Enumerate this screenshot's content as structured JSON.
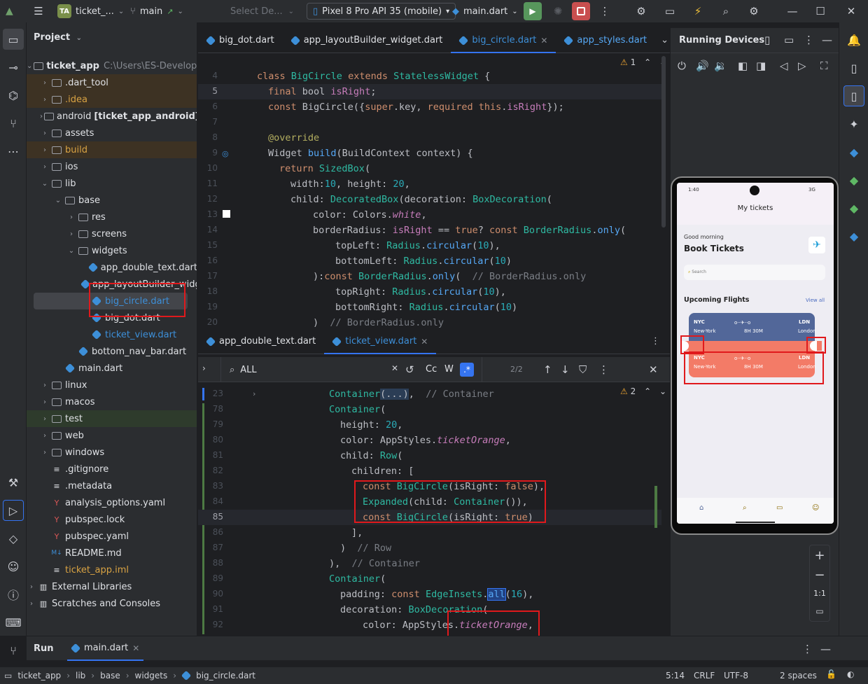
{
  "titlebar": {
    "project_badge": "TA",
    "project_name": "ticket_...",
    "branch": "main",
    "config_placeholder": "Select De...",
    "device": "Pixel 8 Pro API 35 (mobile)",
    "run_config": "main.dart"
  },
  "project_panel": {
    "title": "Project",
    "root_name": "ticket_app",
    "root_path": "C:\\Users\\ES-Developer-s",
    "items": [
      {
        "label": ".dart_tool",
        "kind": "folder"
      },
      {
        "label": ".idea",
        "kind": "folder"
      },
      {
        "label": "android",
        "suffix": "[ticket_app_android]",
        "kind": "folder"
      },
      {
        "label": "assets",
        "kind": "folder"
      },
      {
        "label": "build",
        "kind": "folder"
      },
      {
        "label": "ios",
        "kind": "folder"
      },
      {
        "label": "lib",
        "kind": "folder"
      },
      {
        "label": "base",
        "kind": "folder"
      },
      {
        "label": "res",
        "kind": "folder"
      },
      {
        "label": "screens",
        "kind": "folder"
      },
      {
        "label": "widgets",
        "kind": "folder"
      },
      {
        "label": "app_double_text.dart",
        "kind": "dart"
      },
      {
        "label": "app_layoutBuilder_widge",
        "kind": "dart"
      },
      {
        "label": "big_circle.dart",
        "kind": "dart"
      },
      {
        "label": "big_dot.dart",
        "kind": "dart"
      },
      {
        "label": "ticket_view.dart",
        "kind": "dart"
      },
      {
        "label": "bottom_nav_bar.dart",
        "kind": "dart"
      },
      {
        "label": "main.dart",
        "kind": "dart"
      },
      {
        "label": "linux",
        "kind": "folder"
      },
      {
        "label": "macos",
        "kind": "folder"
      },
      {
        "label": "test",
        "kind": "folder"
      },
      {
        "label": "web",
        "kind": "folder"
      },
      {
        "label": "windows",
        "kind": "folder"
      },
      {
        "label": ".gitignore",
        "kind": "file"
      },
      {
        "label": ".metadata",
        "kind": "file"
      },
      {
        "label": "analysis_options.yaml",
        "kind": "yaml"
      },
      {
        "label": "pubspec.lock",
        "kind": "yaml"
      },
      {
        "label": "pubspec.yaml",
        "kind": "yaml"
      },
      {
        "label": "README.md",
        "kind": "md"
      },
      {
        "label": "ticket_app.iml",
        "kind": "file"
      },
      {
        "label": "External Libraries",
        "kind": "lib"
      },
      {
        "label": "Scratches and Consoles",
        "kind": "lib"
      }
    ]
  },
  "editor_top": {
    "tabs": [
      "big_dot.dart",
      "app_layoutBuilder_widget.dart",
      "big_circle.dart",
      "app_styles.dart"
    ],
    "active_tab": "big_circle.dart",
    "warning_count": "1",
    "line_numbers": [
      "4",
      "5",
      "6",
      "7",
      "8",
      "9",
      "10",
      "11",
      "12",
      "13",
      "14",
      "15",
      "16",
      "17",
      "18",
      "19",
      "20"
    ]
  },
  "editor_bottom": {
    "tabs": [
      "app_double_text.dart",
      "ticket_view.dart"
    ],
    "active_tab": "ticket_view.dart",
    "search_value": "ALL",
    "match_count": "2/2",
    "opt_case": "Cc",
    "opt_word": "W",
    "opt_regex": ".*",
    "warning_count": "2",
    "line_numbers": [
      "23",
      "78",
      "79",
      "80",
      "81",
      "82",
      "83",
      "84",
      "85",
      "86",
      "87",
      "88",
      "89",
      "90",
      "91",
      "92"
    ]
  },
  "running_devices": {
    "title": "Running Devices"
  },
  "phone": {
    "status_time": "1:40",
    "status_right": "3G",
    "app_title": "My tickets",
    "greeting": "Good morning",
    "heading": "Book Tickets",
    "search_placeholder": "Search",
    "section_title": "Upcoming Flights",
    "view_all": "View all",
    "ticket": {
      "from_code": "NYC",
      "to_code": "LDN",
      "from_city": "New-York",
      "to_city": "London",
      "duration": "8H 30M"
    }
  },
  "zoom_ratio": "1:1",
  "run_bar": {
    "label": "Run",
    "tab": "main.dart"
  },
  "status_bar": {
    "crumbs": [
      "ticket_app",
      "lib",
      "base",
      "widgets",
      "big_circle.dart"
    ],
    "position": "5:14",
    "line_ending": "CRLF",
    "encoding": "UTF-8",
    "indent": "2 spaces"
  },
  "colors": {
    "ticket_blue": "#526799",
    "ticket_orange": "#F37B67",
    "highlight": "#e0191c"
  }
}
